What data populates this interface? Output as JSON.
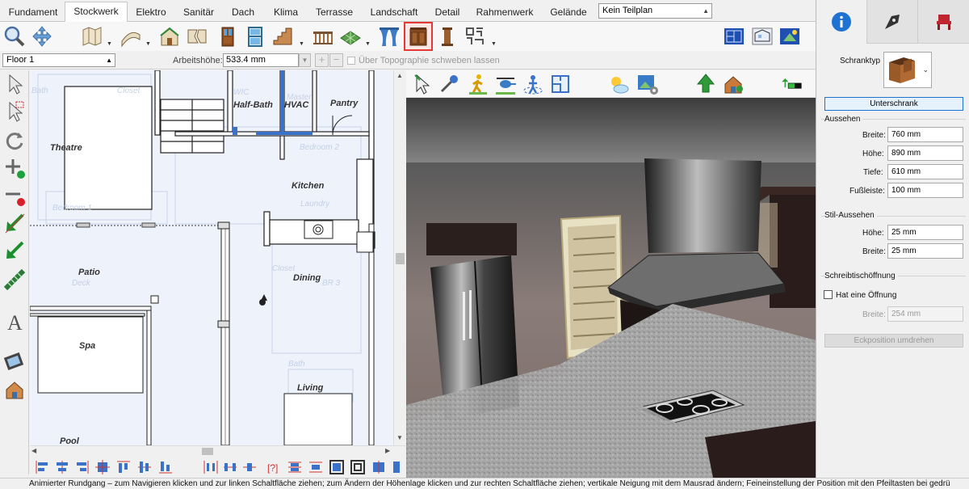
{
  "menu_tabs": [
    "Fundament",
    "Stockwerk",
    "Elektro",
    "Sanitär",
    "Dach",
    "Klima",
    "Terrasse",
    "Landschaft",
    "Detail",
    "Rahmenwerk",
    "Gelände"
  ],
  "active_tab": "Stockwerk",
  "plan_select": {
    "value": "Kein Teilplan"
  },
  "floor_select": {
    "value": "Floor 1"
  },
  "height": {
    "label": "Arbeitshöhe:",
    "value": "533.4 mm"
  },
  "topo": {
    "label": "Über Topographie schweben lassen"
  },
  "plan": {
    "rooms": [
      "Half-Bath",
      "HVAC",
      "Pantry",
      "Theatre",
      "Kitchen",
      "Patio",
      "Dining",
      "Spa",
      "Living",
      "Pool"
    ],
    "ghost_labels": [
      "Bath",
      "Closet",
      "WIC",
      "Master",
      "Bedroom 2",
      "Bedroom 1",
      "Laundry",
      "Deck",
      "Closet",
      "BR 3",
      "Bath"
    ]
  },
  "right_panel": {
    "cabinet_type_label": "Schranktyp",
    "cabinet_type_button": "Unterschrank",
    "appearance": {
      "title": "Aussehen",
      "width_label": "Breite:",
      "width": "760 mm",
      "height_label": "Höhe:",
      "height": "890 mm",
      "depth_label": "Tiefe:",
      "depth": "610 mm",
      "toe_label": "Fußleiste:",
      "toe": "100 mm"
    },
    "style": {
      "title": "Stil-Aussehen",
      "height_label": "Höhe:",
      "height": "25 mm",
      "width_label": "Breite:",
      "width": "25 mm"
    },
    "desk": {
      "title": "Schreibtischöffnung",
      "has_opening_label": "Hat eine Öffnung",
      "width_label": "Breite:",
      "width": "254 mm"
    },
    "flip_button": "Eckposition umdrehen"
  },
  "status": "Animierter Rundgang – zum Navigieren klicken und zur linken Schaltfläche ziehen; zum Ändern der Höhenlage klicken und zur rechten Schaltfläche ziehen; vertikale Neigung mit dem Mausrad ändern; Feineinstellung der Position mit den Pfeiltasten bei gedrü",
  "colors": {
    "accent": "#1e73d2",
    "highlight": "#e53935",
    "plan_bg": "#eef2fb",
    "wall": "#3a72c9"
  }
}
